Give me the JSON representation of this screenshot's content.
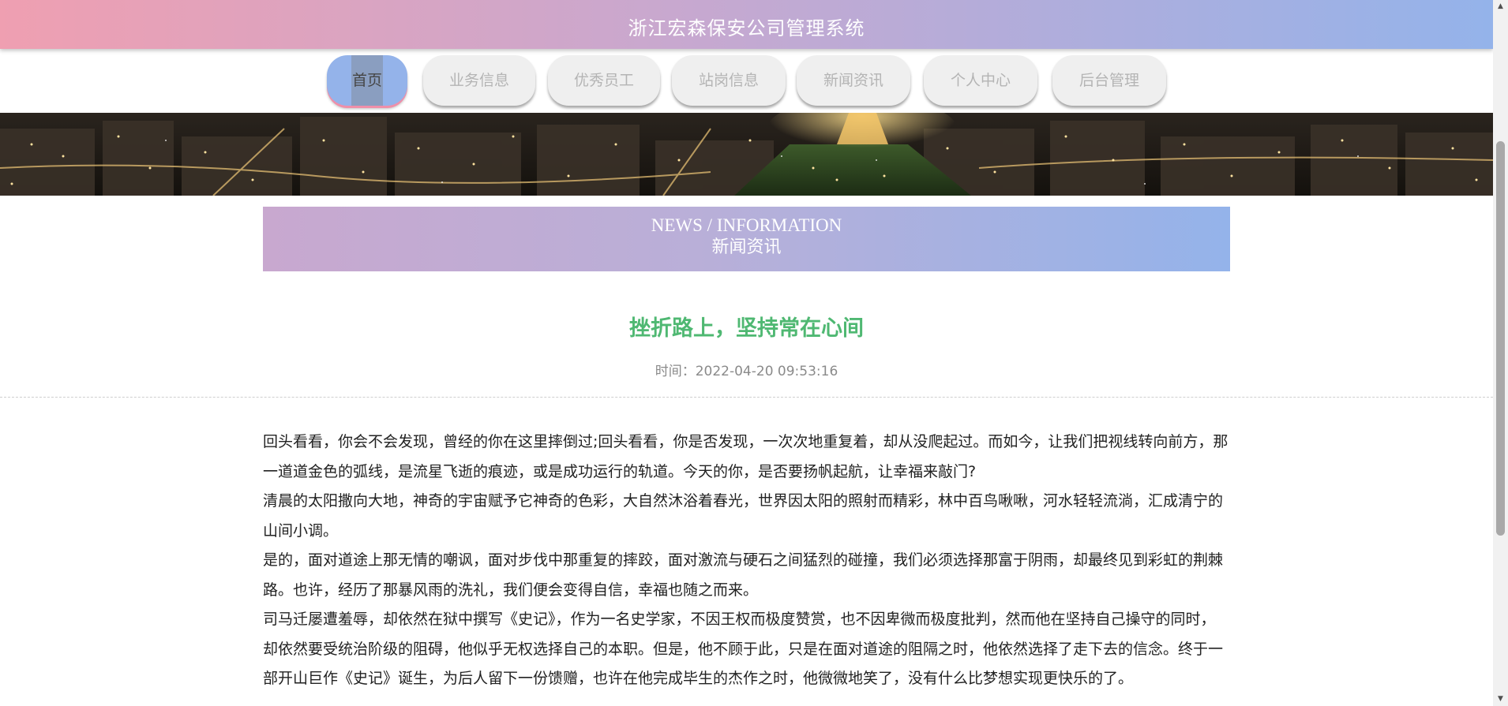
{
  "header": {
    "title": "浙江宏森保安公司管理系统"
  },
  "nav": {
    "items": [
      {
        "label": "首页"
      },
      {
        "label": "业务信息"
      },
      {
        "label": "优秀员工"
      },
      {
        "label": "站岗信息"
      },
      {
        "label": "新闻资讯"
      },
      {
        "label": "个人中心"
      },
      {
        "label": "后台管理"
      }
    ],
    "active_index": 0
  },
  "section": {
    "title_en": "NEWS / INFORMATION",
    "title_cn": "新闻资讯"
  },
  "article": {
    "title": "挫折路上，坚持常在心间",
    "time": "时间：2022-04-20 09:53:16",
    "paragraphs": [
      "回头看看，你会不会发现，曾经的你在这里摔倒过;回头看看，你是否发现，一次次地重复着，却从没爬起过。而如今，让我们把视线转向前方，那一道道金色的弧线，是流星飞逝的痕迹，或是成功运行的轨道。今天的你，是否要扬帆起航，让幸福来敲门?",
      "清晨的太阳撒向大地，神奇的宇宙赋予它神奇的色彩，大自然沐浴着春光，世界因太阳的照射而精彩，林中百鸟啾啾，河水轻轻流淌，汇成清宁的山间小调。",
      "是的，面对道途上那无情的嘲讽，面对步伐中那重复的摔跤，面对激流与硬石之间猛烈的碰撞，我们必须选择那富于阴雨，却最终见到彩虹的荆棘路。也许，经历了那暴风雨的洗礼，我们便会变得自信，幸福也随之而来。",
      "司马迁屡遭羞辱，却依然在狱中撰写《史记》，作为一名史学家，不因王权而极度赞赏，也不因卑微而极度批判，然而他在坚持自己操守的同时，却依然要受统治阶级的阻碍，他似乎无权选择自己的本职。但是，他不顾于此，只是在面对道途的阻隔之时，他依然选择了走下去的信念。终于一部开山巨作《史记》诞生，为后人留下一份馈赠，也许在他完成毕生的杰作之时，他微微地笑了，没有什么比梦想实现更快乐的了。"
    ]
  },
  "colors": {
    "header_gradient_start": "#ef9fb1",
    "header_gradient_end": "#94b3ea",
    "nav_active_bg": "#94b3ea",
    "nav_active_underline": "#ef8fa9",
    "nav_inactive_bg": "#efefef",
    "nav_inactive_text": "#b4b4b4",
    "title_green": "#4fb872",
    "time_gray": "#8a8a8a"
  },
  "icons": {
    "banner": "city-night-photo",
    "scroll_up": "chevron-up-icon",
    "scroll_down": "chevron-down-icon"
  }
}
